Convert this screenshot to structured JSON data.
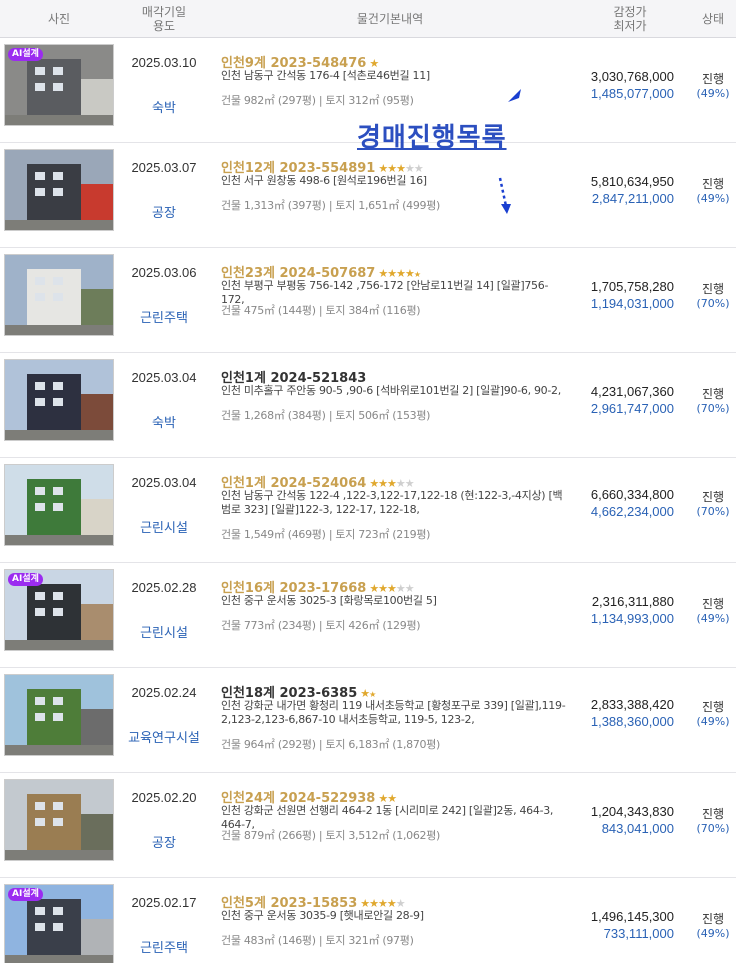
{
  "header": {
    "photo": "사진",
    "date_line1": "매각기일",
    "date_line2": "용도",
    "info": "물건기본내역",
    "price_line1": "감정가",
    "price_line2": "최저가",
    "status": "상태"
  },
  "overlay_title": "경매진행목록",
  "ai_badge": "AI설계",
  "colors": {
    "accent_blue": "#2a62b5",
    "case_gold": "#c8a050",
    "badge_purple": "#9b2cf0",
    "overlay_blue": "#2c4fc0"
  },
  "rows": [
    {
      "date": "2025.03.10",
      "usage": "숙박",
      "case": "인천9계 2023-548476",
      "stars": 1,
      "half": false,
      "ai": true,
      "case_dark": false,
      "addr": "인천 남동구 간석동 176-4 [석촌로46번길 11]",
      "area": "건물 982㎡ (297평)   |   토지 312㎡ (95평)",
      "appraisal": "3,030,768,000",
      "min": "1,485,077,000",
      "status": "진행",
      "pct": "(49%)"
    },
    {
      "date": "2025.03.07",
      "usage": "공장",
      "case": "인천12계 2023-554891",
      "stars": 3,
      "half": false,
      "ai": false,
      "case_dark": false,
      "addr": "인천 서구 원창동 498-6 [원석로196번길 16]",
      "area": "건물 1,313㎡ (397평)   |   토지 1,651㎡ (499평)",
      "appraisal": "5,810,634,950",
      "min": "2,847,211,000",
      "status": "진행",
      "pct": "(49%)"
    },
    {
      "date": "2025.03.06",
      "usage": "근린주택",
      "case": "인천23계 2024-507687",
      "stars": 4,
      "half": true,
      "ai": false,
      "case_dark": false,
      "addr": "인천 부평구 부평동 756-142 ,756-172 [안남로11번길 14]  [일괄]756-172,",
      "area": "건물 475㎡ (144평)   |   토지 384㎡ (116평)",
      "appraisal": "1,705,758,280",
      "min": "1,194,031,000",
      "status": "진행",
      "pct": "(70%)"
    },
    {
      "date": "2025.03.04",
      "usage": "숙박",
      "case": "인천1계 2024-521843",
      "stars": 0,
      "half": false,
      "ai": false,
      "case_dark": true,
      "addr": "인천 미추홀구 주안동 90-5 ,90-6 [석바위로101번길 2]  [일괄]90-6, 90-2,",
      "area": "건물 1,268㎡ (384평)   |   토지 506㎡ (153평)",
      "appraisal": "4,231,067,360",
      "min": "2,961,747,000",
      "status": "진행",
      "pct": "(70%)"
    },
    {
      "date": "2025.03.04",
      "usage": "근린시설",
      "case": "인천1계 2024-524064",
      "stars": 3,
      "half": false,
      "ai": false,
      "case_dark": false,
      "addr": "인천 남동구 간석동 122-4 ,122-3,122-17,122-18 (현:122-3,-4지상) [백범로 323]  [일괄]122-3, 122-17, 122-18,",
      "area": "건물 1,549㎡ (469평)   |   토지 723㎡ (219평)",
      "appraisal": "6,660,334,800",
      "min": "4,662,234,000",
      "status": "진행",
      "pct": "(70%)"
    },
    {
      "date": "2025.02.28",
      "usage": "근린시설",
      "case": "인천16계 2023-17668",
      "stars": 3,
      "half": false,
      "ai": true,
      "case_dark": false,
      "addr": "인천 중구 운서동 3025-3 [화랑목로100번길 5]",
      "area": "건물 773㎡ (234평)   |   토지 426㎡ (129평)",
      "appraisal": "2,316,311,880",
      "min": "1,134,993,000",
      "status": "진행",
      "pct": "(49%)"
    },
    {
      "date": "2025.02.24",
      "usage": "교육연구시설",
      "case": "인천18계 2023-6385",
      "stars": 1,
      "half": true,
      "ai": false,
      "case_dark": true,
      "addr": "인천 강화군 내가면 황청리 119 내서초등학교 [황청포구로 339]  [일괄],119-2,123-2,123-6,867-10 내서초등학교, 119-5, 123-2,",
      "area": "건물 964㎡ (292평)   |   토지 6,183㎡ (1,870평)",
      "appraisal": "2,833,388,420",
      "min": "1,388,360,000",
      "status": "진행",
      "pct": "(49%)"
    },
    {
      "date": "2025.02.20",
      "usage": "공장",
      "case": "인천24계 2024-522938",
      "stars": 2,
      "half": false,
      "ai": false,
      "case_dark": false,
      "addr": "인천 강화군 선원면 선행리 464-2 1동 [시리미로 242]  [일괄]2동, 464-3, 464-7,",
      "area": "건물 879㎡ (266평)   |   토지 3,512㎡ (1,062평)",
      "appraisal": "1,204,343,830",
      "min": "843,041,000",
      "status": "진행",
      "pct": "(70%)"
    },
    {
      "date": "2025.02.17",
      "usage": "근린주택",
      "case": "인천5계 2023-15853",
      "stars": 4,
      "half": false,
      "ai": true,
      "case_dark": false,
      "addr": "인천 중구 운서동 3035-9 [햇내로안길 28-9]",
      "area": "건물 483㎡ (146평)   |   토지 321㎡ (97평)",
      "appraisal": "1,496,145,300",
      "min": "733,111,000",
      "status": "진행",
      "pct": "(49%)"
    }
  ]
}
